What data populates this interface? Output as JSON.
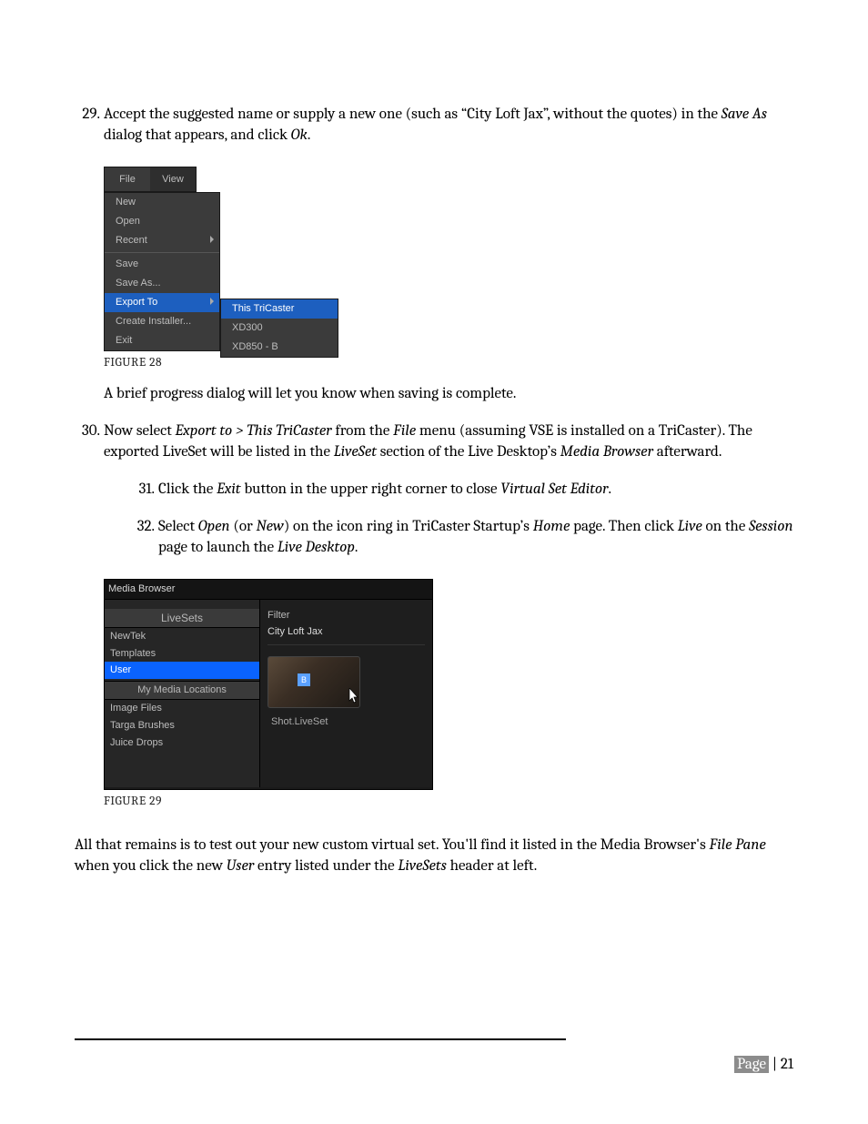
{
  "steps": {
    "s29_num": "29.",
    "s29_a": "Accept the suggested name or supply a new one (such as “City Loft Jax”, without the quotes) in the ",
    "s29_i1": "Save As",
    "s29_b": " dialog that appears, and click ",
    "s29_i2": "Ok",
    "s29_c": ".",
    "s30_num": "30.",
    "s30_a": "Now select ",
    "s30_i1": "Export to > This TriCaster",
    "s30_b": " from the ",
    "s30_i2": "File",
    "s30_c": " menu (assuming VSE is installed on a TriCaster). The exported LiveSet will be listed in the ",
    "s30_i3": "LiveSet ",
    "s30_d": "section of the Live Desktop’s ",
    "s30_i4": "Media Browser",
    "s30_e": " afterward."
  },
  "after28": "A brief progress dialog will let you know when saving is complete.",
  "sub31": {
    "num": "31.",
    "a": "Click the ",
    "i1": "Exit",
    "b": " button in the upper right corner to close ",
    "i2": "Virtual Set Editor",
    "c": "."
  },
  "sub32": {
    "num": "32.",
    "a": "Select ",
    "i1": "Open",
    "b": " (or ",
    "i2": "New",
    "c": ") on the icon ring in TriCaster Startup’s ",
    "i3": "Home",
    "d": " page.  Then click ",
    "i4": "Live",
    "e": " on the ",
    "i5": "Session",
    "f": " page to launch the ",
    "i6": "Live Desktop",
    "g": "."
  },
  "closing": {
    "a": "All that remains is to test out your new custom virtual set.  You'll find it listed in the Media Browser's ",
    "i1": "File Pane",
    "b": " when you click the new ",
    "i2": "User",
    "c": " entry listed under the ",
    "i3": "LiveSets",
    "d": " header at left."
  },
  "fig28": {
    "caption": "FIGURE 28",
    "menubar": {
      "file": "File",
      "view": "View"
    },
    "items": {
      "new": "New",
      "open": "Open",
      "recent": "Recent",
      "save": "Save",
      "saveas": "Save As...",
      "export": "Export To",
      "createinstaller": "Create Installer...",
      "exit": "Exit"
    },
    "submenu": {
      "thistc": "This TriCaster",
      "xd300": "XD300",
      "xd850b": "XD850 - B"
    }
  },
  "fig29": {
    "caption": "FIGURE 29",
    "title": "Media Browser",
    "left": {
      "header": "LiveSets",
      "newtek": "NewTek",
      "templates": "Templates",
      "user": "User",
      "subheader": "My Media Locations",
      "imagefiles": "Image Files",
      "targa": "Targa Brushes",
      "juice": "Juice Drops"
    },
    "right": {
      "filterlabel": "Filter",
      "filtervalue": "City Loft Jax",
      "thumbB": "B",
      "thumbname": "Shot.LiveSet"
    }
  },
  "footer": {
    "page_word": "Page",
    "sep": " | ",
    "num": "21"
  }
}
